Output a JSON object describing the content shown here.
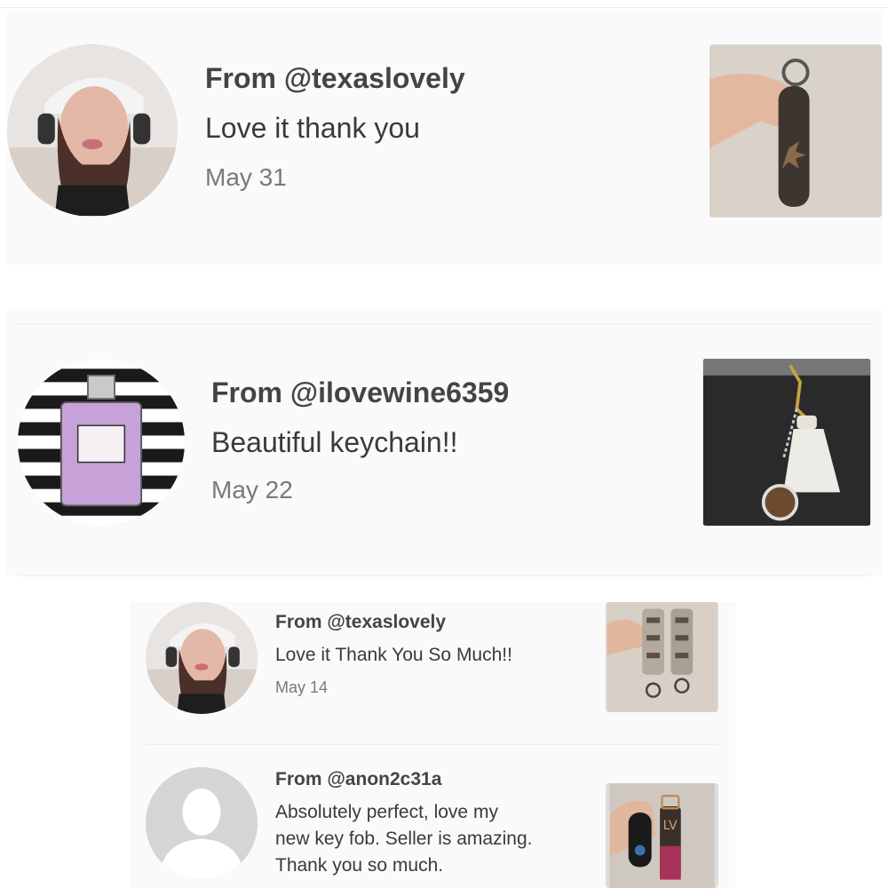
{
  "colors": {
    "card_bg": "#fbfafb",
    "divider": "#ececec",
    "text": "#3b3b3b",
    "muted": "#7a7a7a"
  },
  "reviews": [
    {
      "from": "From @texaslovely",
      "message": "Love it thank you",
      "date": "May 31",
      "avatar_icon": "user-photo-icon",
      "thumb_icon": "keychain-photo-icon"
    },
    {
      "from": "From @ilovewine6359",
      "message": "Beautiful keychain!!",
      "date": "May 22",
      "avatar_icon": "perfume-bottle-icon",
      "thumb_icon": "bag-charm-photo-icon"
    },
    {
      "from": "From @texaslovely",
      "message": "Love it Thank You So Much!!",
      "date": "May 14",
      "avatar_icon": "user-photo-icon",
      "thumb_icon": "strap-photo-icon"
    },
    {
      "from": "From @anon2c31a",
      "message_lines": [
        "Absolutely perfect, love my",
        "new key fob. Seller is amazing.",
        "Thank you so much."
      ],
      "avatar_icon": "default-avatar-icon",
      "thumb_icon": "key-fob-photo-icon"
    }
  ]
}
